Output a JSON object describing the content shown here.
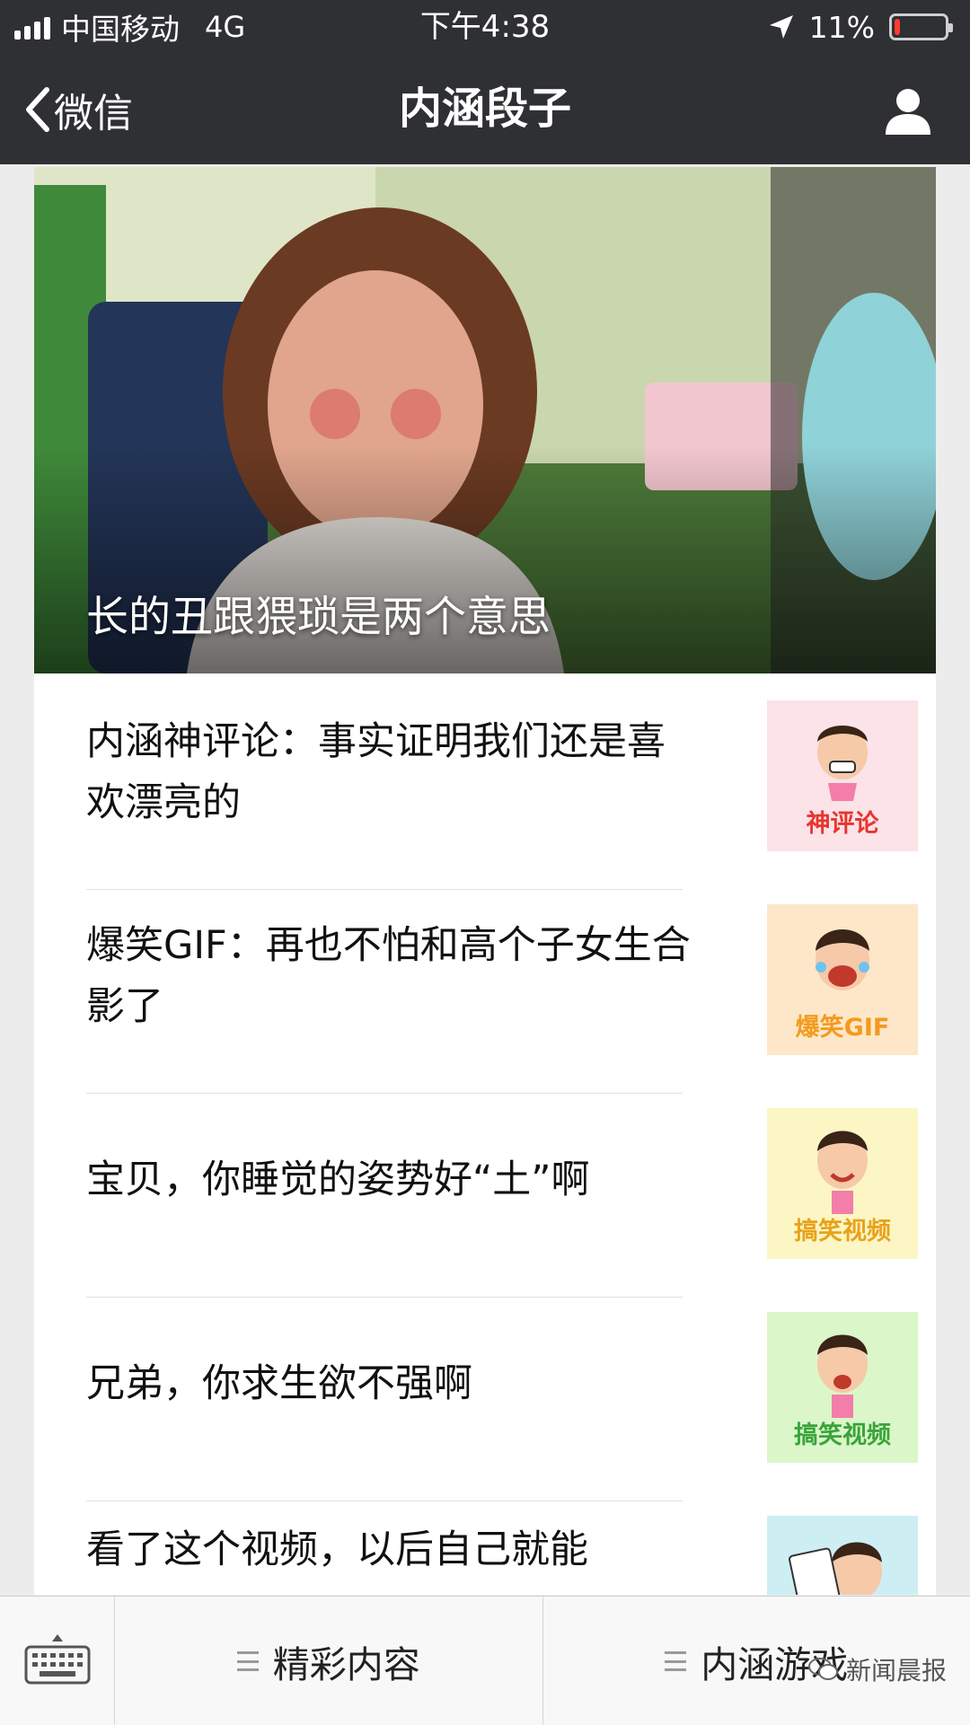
{
  "status_bar": {
    "carrier": "中国移动",
    "network": "4G",
    "time": "下午4:38",
    "battery_percent": "11%",
    "battery_level": 0.11,
    "battery_color": "#ff3b30"
  },
  "nav": {
    "back_label": "微信",
    "title": "内涵段子",
    "right_icon": "user-icon"
  },
  "hero": {
    "caption": "长的丑跟猥琐是两个意思"
  },
  "articles": [
    {
      "title": "内涵神评论：事实证明我们还是喜欢漂亮的",
      "thumb_label": "神评论",
      "thumb_bg": "#fbe3e7",
      "thumb_color": "#e8342f"
    },
    {
      "title": "爆笑GIF：再也不怕和高个子女生合影了",
      "thumb_label": "爆笑GIF",
      "thumb_bg": "#fde7c8",
      "thumb_color": "#f39a1c"
    },
    {
      "title": "宝贝，你睡觉的姿势好“土”啊",
      "thumb_label": "搞笑视频",
      "thumb_bg": "#fbf6c4",
      "thumb_color": "#e9a21a"
    },
    {
      "title": "兄弟，你求生欲不强啊",
      "thumb_label": "搞笑视频",
      "thumb_bg": "#dbf6c8",
      "thumb_color": "#3aa43a"
    },
    {
      "title": "看了这个视频，以后自己就能",
      "thumb_label": "",
      "thumb_bg": "#cdeff3",
      "thumb_color": "#2a9aa8"
    }
  ],
  "bottom_menu": {
    "keyboard_icon": "keyboard-icon",
    "items": [
      "精彩内容",
      "内涵游戏"
    ]
  },
  "watermark": {
    "text": "新闻晨报",
    "icon": "wechat-icon"
  }
}
